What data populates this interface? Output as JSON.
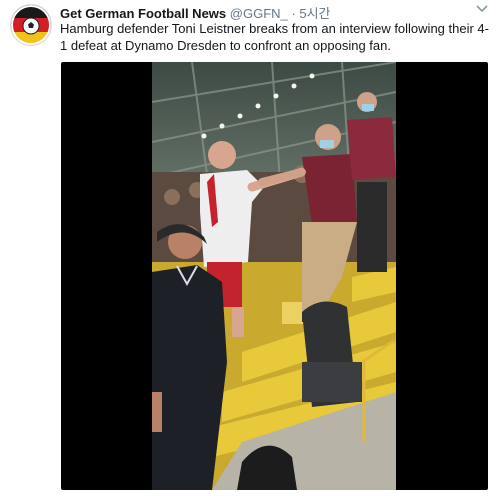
{
  "tweet": {
    "author_name": "Get German Football News",
    "author_handle": "@GGFN_",
    "separator": "·",
    "timestamp": "5시간",
    "text": "Hamburg defender Toni Leistner breaks from an interview following their 4-1 defeat at Dynamo Dresden to confront an opposing fan."
  },
  "icons": {
    "avatar": "ggfn-logo",
    "menu": "chevron-down-icon"
  },
  "colors": {
    "text": "#14171a",
    "secondary": "#657786",
    "media_background": "#000000",
    "seat_yellow": "#e8c93a",
    "logo_red": "#d21f26",
    "logo_gold": "#f2c21b"
  }
}
